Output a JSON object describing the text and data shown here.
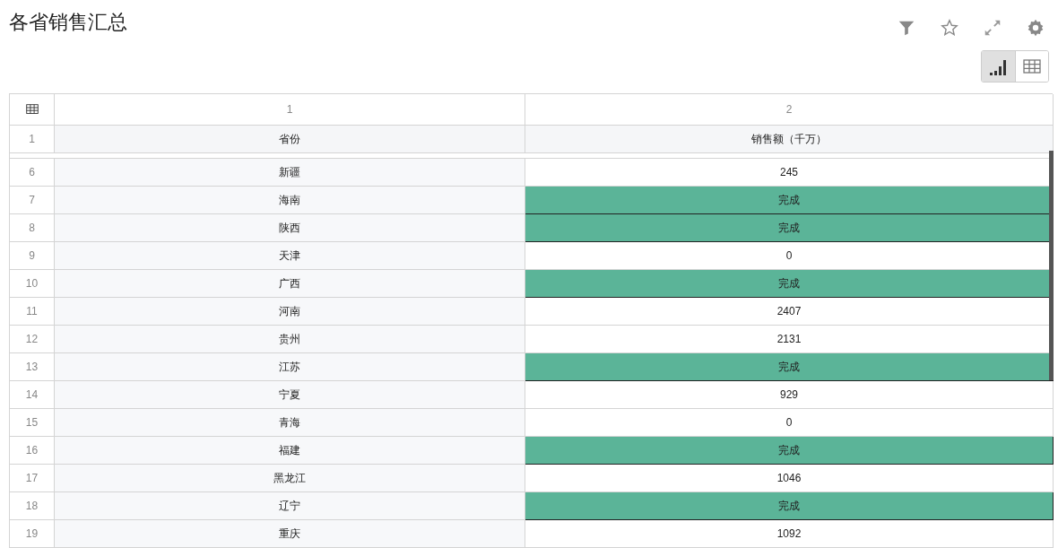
{
  "title": "各省销售汇总",
  "view_toggle": [
    {
      "kind": "chart",
      "selected": true
    },
    {
      "kind": "table",
      "selected": false
    }
  ],
  "table": {
    "column_numbers": [
      "1",
      "2"
    ],
    "header": {
      "row_number": "1",
      "cells": [
        "省份",
        "销售额（千万）"
      ]
    },
    "rows": [
      {
        "row_number": "6",
        "province": "新疆",
        "value": "245",
        "highlighted": false
      },
      {
        "row_number": "7",
        "province": "海南",
        "value": "完成",
        "highlighted": true
      },
      {
        "row_number": "8",
        "province": "陕西",
        "value": "完成",
        "highlighted": true
      },
      {
        "row_number": "9",
        "province": "天津",
        "value": "0",
        "highlighted": false
      },
      {
        "row_number": "10",
        "province": "广西",
        "value": "完成",
        "highlighted": true
      },
      {
        "row_number": "11",
        "province": "河南",
        "value": "2407",
        "highlighted": false
      },
      {
        "row_number": "12",
        "province": "贵州",
        "value": "2131",
        "highlighted": false
      },
      {
        "row_number": "13",
        "province": "江苏",
        "value": "完成",
        "highlighted": true
      },
      {
        "row_number": "14",
        "province": "宁夏",
        "value": "929",
        "highlighted": false
      },
      {
        "row_number": "15",
        "province": "青海",
        "value": "0",
        "highlighted": false
      },
      {
        "row_number": "16",
        "province": "福建",
        "value": "完成",
        "highlighted": true
      },
      {
        "row_number": "17",
        "province": "黑龙江",
        "value": "1046",
        "highlighted": false
      },
      {
        "row_number": "18",
        "province": "辽宁",
        "value": "完成",
        "highlighted": true
      },
      {
        "row_number": "19",
        "province": "重庆",
        "value": "1092",
        "highlighted": false
      }
    ]
  }
}
